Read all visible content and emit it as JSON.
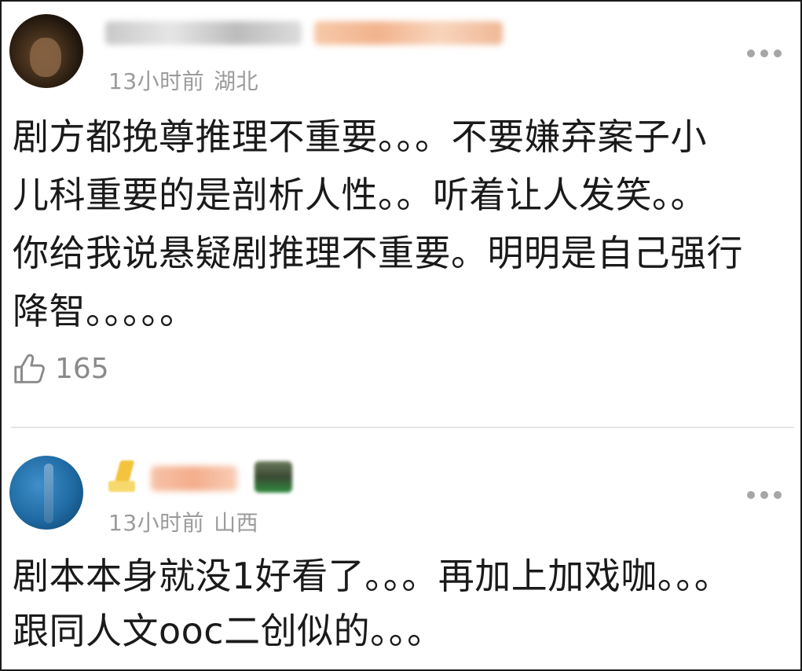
{
  "comments": [
    {
      "time": "13小时前",
      "location": "湖北",
      "text": "剧方都挽尊推理不重要。。。不要嫌弃案子小\n儿科重要的是剖析人性。。听着让人发笑。。\n你给我说悬疑剧推理不重要。明明是自己强行\n降智。。。。。",
      "likes": "165",
      "icons": {
        "avatar": "avatar",
        "more": "more-dots-icon",
        "like": "thumbs-up-icon"
      }
    },
    {
      "time": "13小时前",
      "location": "山西",
      "text": "剧本本身就没1好看了。。。再加上加戏咖。。。\n跟同人文ooc二创似的。。。",
      "icons": {
        "avatar": "avatar",
        "more": "more-dots-icon",
        "badge": "badge-icon"
      }
    }
  ]
}
